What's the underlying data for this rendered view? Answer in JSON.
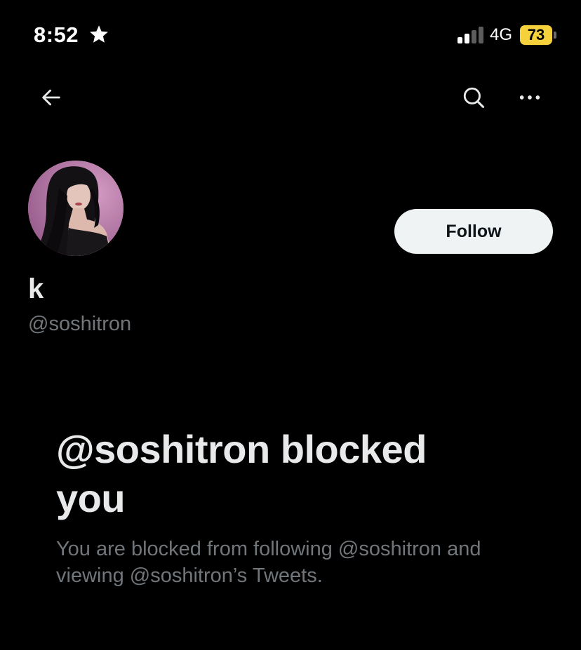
{
  "status_bar": {
    "time": "8:52",
    "time_icon": "star-icon",
    "signal_icon": "cellular-signal-icon",
    "network": "4G",
    "battery_level": "73",
    "battery_color": "#f5d13b"
  },
  "nav": {
    "back_icon": "arrow-left-icon",
    "search_icon": "search-icon",
    "more_icon": "more-horizontal-icon"
  },
  "profile": {
    "avatar": "profile-avatar",
    "display_name": "k",
    "handle": "@soshitron",
    "follow_label": "Follow"
  },
  "blocked_notice": {
    "title": "@soshitron blocked you",
    "message": "You are blocked from following @soshitron and viewing @soshitron’s Tweets."
  },
  "colors": {
    "background": "#000000",
    "primary_text": "#e7e9ea",
    "secondary_text": "#71767b",
    "follow_button_bg": "#eff3f4",
    "follow_button_text": "#0f1419"
  }
}
